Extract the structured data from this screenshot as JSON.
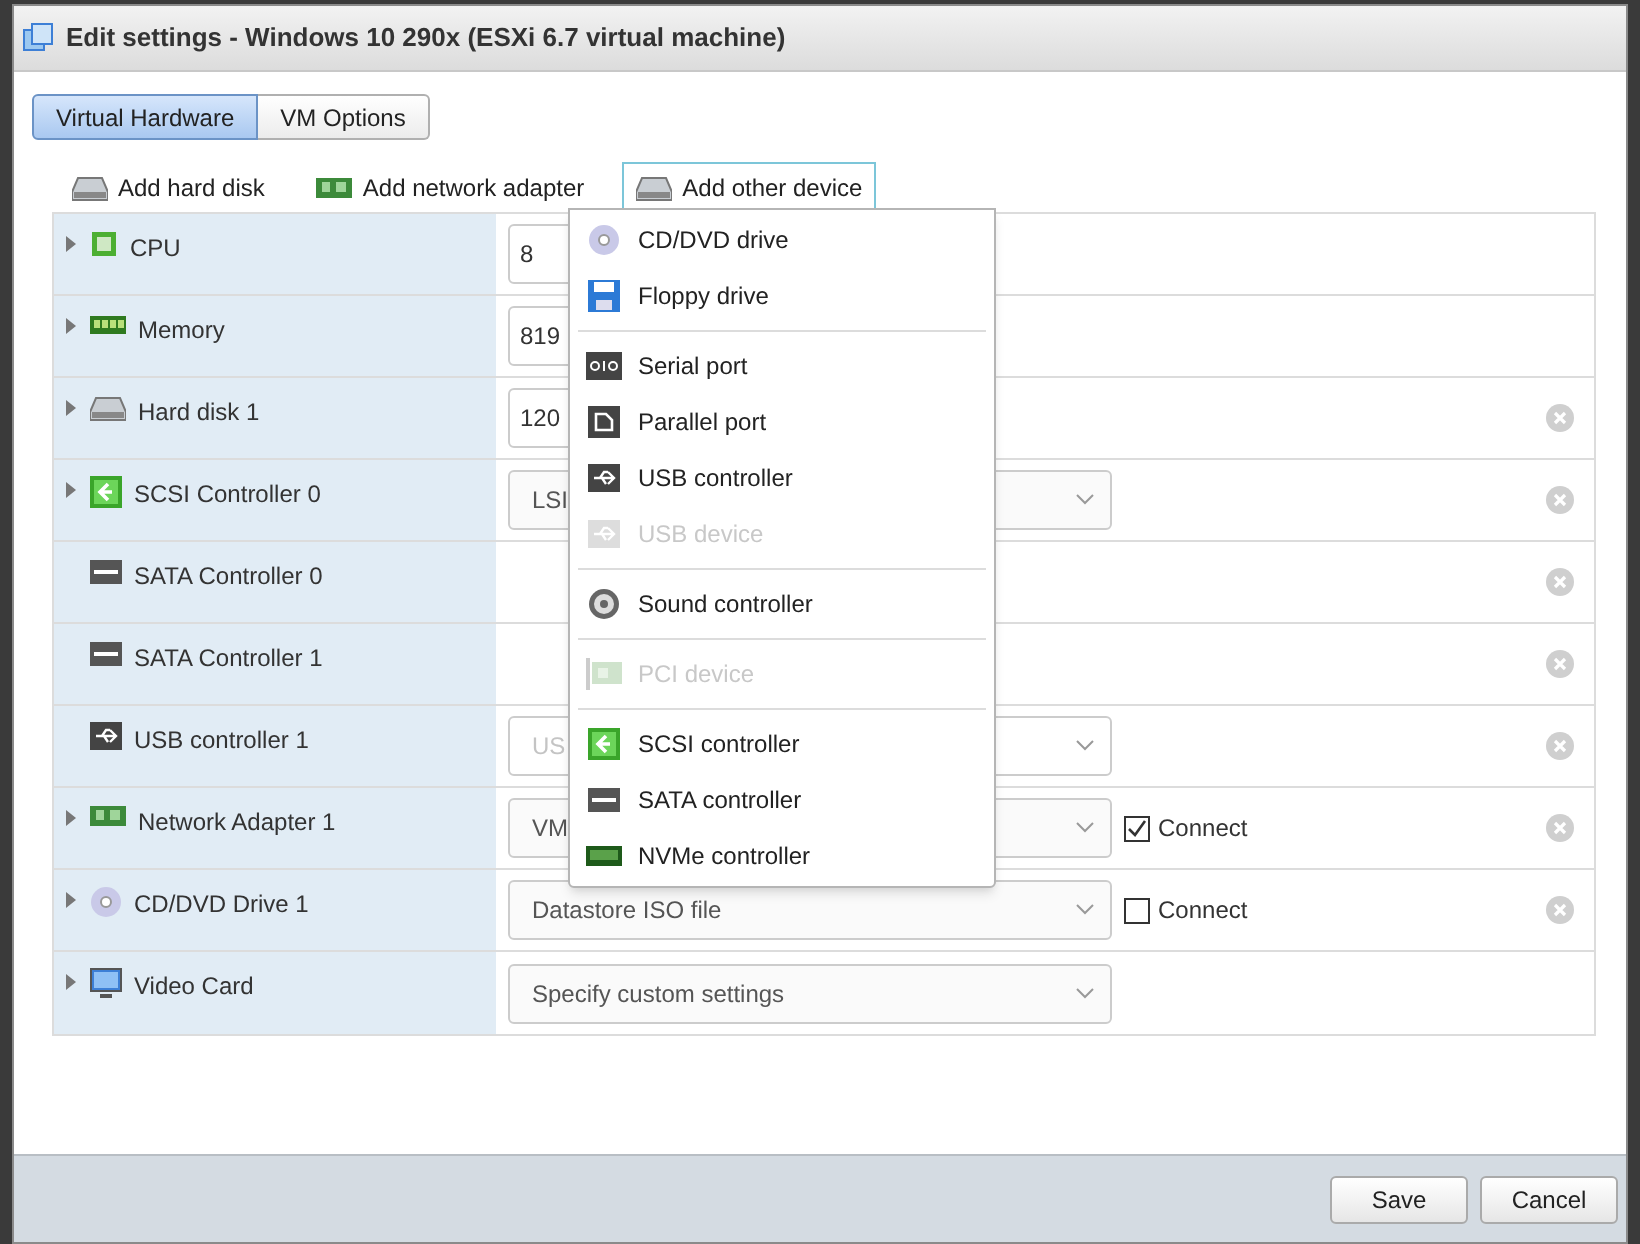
{
  "window": {
    "title": "Edit settings - Windows 10 290x (ESXi 6.7 virtual machine)"
  },
  "tabs": [
    {
      "label": "Virtual Hardware",
      "selected": true
    },
    {
      "label": "VM Options",
      "selected": false
    }
  ],
  "toolbar": [
    {
      "label": "Add hard disk",
      "active": false
    },
    {
      "label": "Add network adapter",
      "active": false
    },
    {
      "label": "Add other device",
      "active": true
    }
  ],
  "hardware": [
    {
      "label": "CPU",
      "expandable": true,
      "field": {
        "kind": "input",
        "value": "8"
      },
      "removable": false
    },
    {
      "label": "Memory",
      "expandable": true,
      "field": {
        "kind": "input",
        "value": "819"
      },
      "removable": false
    },
    {
      "label": "Hard disk 1",
      "expandable": true,
      "field": {
        "kind": "input",
        "value": "120"
      },
      "removable": true
    },
    {
      "label": "SCSI Controller 0",
      "expandable": true,
      "field": {
        "kind": "select",
        "value": "LSI",
        "disabled": false
      },
      "removable": true
    },
    {
      "label": "SATA Controller 0",
      "expandable": false,
      "field": {
        "kind": "none"
      },
      "removable": true
    },
    {
      "label": "SATA Controller 1",
      "expandable": false,
      "field": {
        "kind": "none"
      },
      "removable": true
    },
    {
      "label": "USB controller 1",
      "expandable": false,
      "field": {
        "kind": "select",
        "value": "US",
        "disabled": true
      },
      "removable": true
    },
    {
      "label": "Network Adapter 1",
      "expandable": true,
      "field": {
        "kind": "select",
        "value": "VM",
        "disabled": false
      },
      "connect": {
        "label": "Connect",
        "checked": true
      },
      "removable": true
    },
    {
      "label": "CD/DVD Drive 1",
      "expandable": true,
      "field": {
        "kind": "select",
        "value": "Datastore ISO file",
        "disabled": false
      },
      "connect": {
        "label": "Connect",
        "checked": false
      },
      "removable": true
    },
    {
      "label": "Video Card",
      "expandable": true,
      "field": {
        "kind": "select",
        "value": "Specify custom settings",
        "disabled": false
      },
      "removable": false
    }
  ],
  "device_menu": [
    {
      "kind": "item",
      "label": "CD/DVD drive",
      "disabled": false
    },
    {
      "kind": "item",
      "label": "Floppy drive",
      "disabled": false
    },
    {
      "kind": "separator"
    },
    {
      "kind": "item",
      "label": "Serial port",
      "disabled": false
    },
    {
      "kind": "item",
      "label": "Parallel port",
      "disabled": false
    },
    {
      "kind": "item",
      "label": "USB controller",
      "disabled": false
    },
    {
      "kind": "item",
      "label": "USB device",
      "disabled": true
    },
    {
      "kind": "separator"
    },
    {
      "kind": "item",
      "label": "Sound controller",
      "disabled": false
    },
    {
      "kind": "separator"
    },
    {
      "kind": "item",
      "label": "PCI device",
      "disabled": true
    },
    {
      "kind": "separator"
    },
    {
      "kind": "item",
      "label": "SCSI controller",
      "disabled": false
    },
    {
      "kind": "item",
      "label": "SATA controller",
      "disabled": false
    },
    {
      "kind": "item",
      "label": "NVMe controller",
      "disabled": false
    }
  ],
  "buttons": [
    "Save",
    "Cancel"
  ]
}
